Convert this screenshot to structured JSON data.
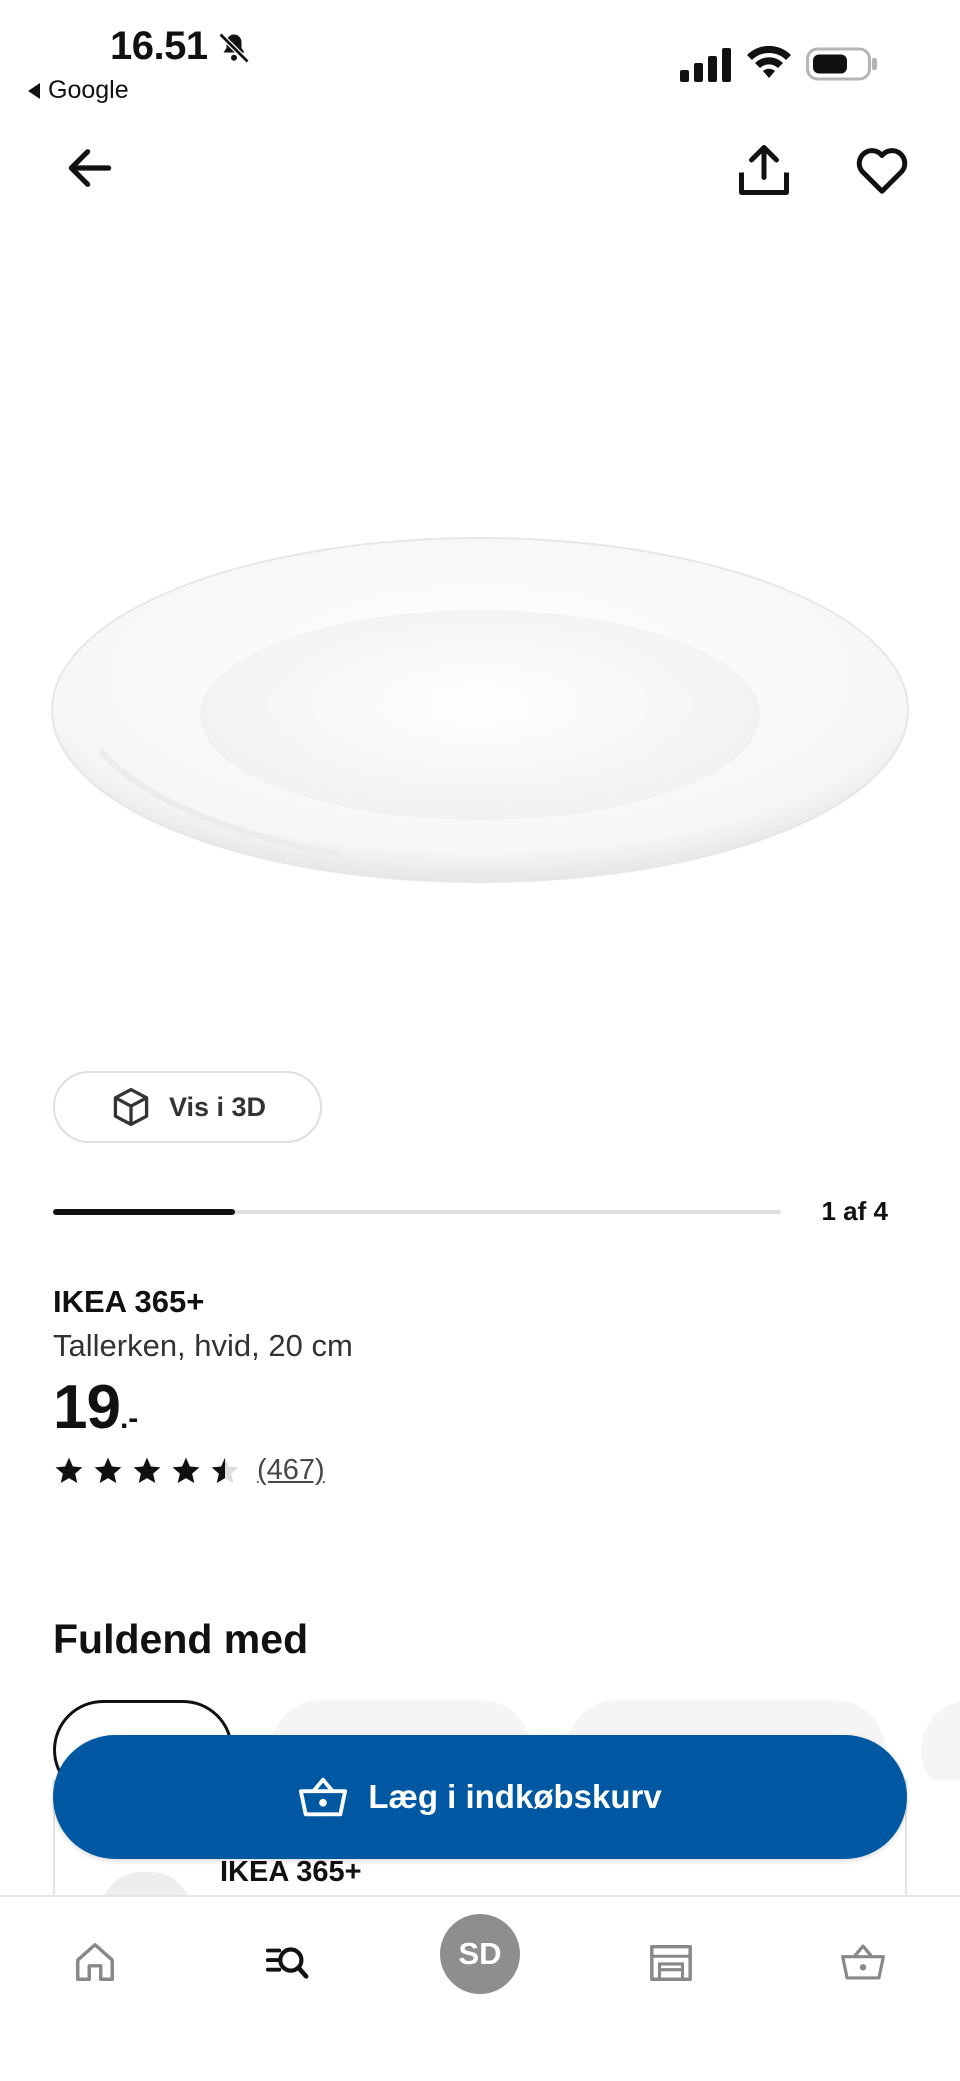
{
  "status_bar": {
    "time": "16.51",
    "back_app": "Google"
  },
  "icons": {
    "back": "arrow-left-icon",
    "share": "share-icon",
    "favorite": "heart-icon",
    "cube": "cube-3d-icon",
    "cart": "basket-icon",
    "home": "home-icon",
    "search": "search-icon",
    "stores": "store-icon"
  },
  "gallery": {
    "view_3d_label": "Vis i 3D",
    "counter": "1 af 4",
    "current": 1,
    "total": 4
  },
  "product": {
    "name": "IKEA 365+",
    "description": "Tallerken, hvid, 20 cm",
    "price_integer": "19",
    "price_decimal": ".-",
    "rating": 4.5,
    "rating_max": 5,
    "review_count": "(467)"
  },
  "complete_with": {
    "title": "Fuldend med",
    "item_name": "IKEA 365+"
  },
  "actions": {
    "add_to_cart": "Læg i indkøbskurv"
  },
  "tab_bar": {
    "avatar_initials": "SD"
  },
  "colors": {
    "primary": "#0058a3",
    "text": "#111111",
    "avatar": "#8e8e8e"
  }
}
